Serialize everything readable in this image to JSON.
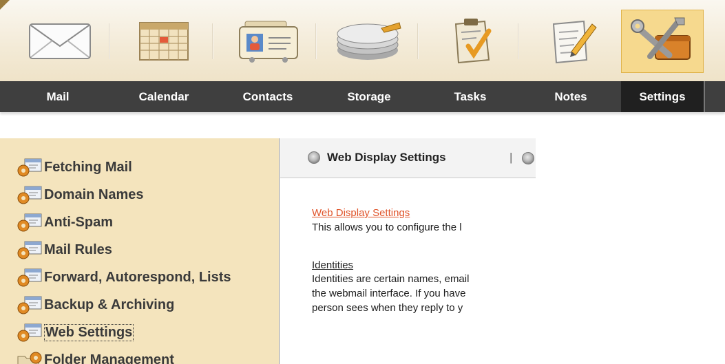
{
  "nav": {
    "items": [
      {
        "label": "Mail",
        "icon": "envelope-icon"
      },
      {
        "label": "Calendar",
        "icon": "calendar-icon"
      },
      {
        "label": "Contacts",
        "icon": "contact-card-icon"
      },
      {
        "label": "Storage",
        "icon": "disk-storage-icon"
      },
      {
        "label": "Tasks",
        "icon": "clipboard-check-icon"
      },
      {
        "label": "Notes",
        "icon": "notepad-pencil-icon"
      },
      {
        "label": "Settings",
        "icon": "tools-icon"
      }
    ],
    "active": "Settings"
  },
  "sidebar": {
    "items": [
      {
        "label": "Fetching Mail"
      },
      {
        "label": "Domain Names"
      },
      {
        "label": "Anti-Spam"
      },
      {
        "label": "Mail Rules"
      },
      {
        "label": "Forward, Autorespond, Lists"
      },
      {
        "label": "Backup & Archiving"
      },
      {
        "label": "Web Settings"
      },
      {
        "label": "Folder Management"
      }
    ],
    "selected": "Web Settings"
  },
  "main": {
    "tab_label": "Web Display Settings",
    "tab_separator": "|",
    "section1_link": "Web Display Settings",
    "section1_text": "This allows you to configure the l",
    "section2_link": "Identities",
    "section2_line1": "Identities are certain names, email",
    "section2_line2": "the webmail interface. If you have",
    "section2_line3": "person sees when they reply to y"
  },
  "colors": {
    "nav_bg": "#3f3f3f",
    "nav_active_bg": "#202020",
    "sidebar_bg": "#f4e4bd",
    "active_icon_bg": "#f6d98e",
    "link_orange": "#e0542a"
  }
}
